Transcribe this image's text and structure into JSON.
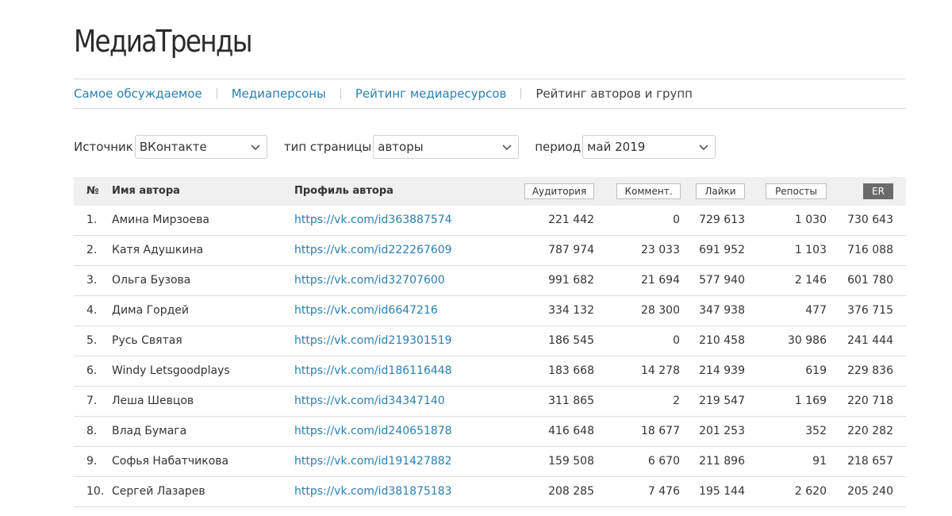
{
  "brand": "МедиаТренды",
  "nav": {
    "items": [
      {
        "label": "Самое обсуждаемое"
      },
      {
        "label": "Медиаперсоны"
      },
      {
        "label": "Рейтинг медиаресурсов"
      }
    ],
    "current": "Рейтинг авторов и групп"
  },
  "filters": {
    "source": {
      "label": "Источник",
      "value": "ВКонтакте"
    },
    "page_type": {
      "label": "тип страницы",
      "value": "авторы"
    },
    "period": {
      "label": "период",
      "value": "май 2019"
    }
  },
  "table": {
    "headers": {
      "num": "№",
      "name": "Имя автора",
      "profile": "Профиль автора",
      "audience": "Аудитория",
      "comments": "Коммент.",
      "likes": "Лайки",
      "reposts": "Репосты",
      "er": "ER"
    },
    "rows": [
      {
        "n": "1.",
        "name": "Амина Мирзоева",
        "url": "https://vk.com/id363887574",
        "audience": "221 442",
        "comments": "0",
        "likes": "729 613",
        "reposts": "1 030",
        "er": "730 643"
      },
      {
        "n": "2.",
        "name": "Катя Адушкина",
        "url": "https://vk.com/id222267609",
        "audience": "787 974",
        "comments": "23 033",
        "likes": "691 952",
        "reposts": "1 103",
        "er": "716 088"
      },
      {
        "n": "3.",
        "name": "Ольга Бузова",
        "url": "https://vk.com/id32707600",
        "audience": "991 682",
        "comments": "21 694",
        "likes": "577 940",
        "reposts": "2 146",
        "er": "601 780"
      },
      {
        "n": "4.",
        "name": "Дима Гордей",
        "url": "https://vk.com/id6647216",
        "audience": "334 132",
        "comments": "28 300",
        "likes": "347 938",
        "reposts": "477",
        "er": "376 715"
      },
      {
        "n": "5.",
        "name": "Русь Святая",
        "url": "https://vk.com/id219301519",
        "audience": "186 545",
        "comments": "0",
        "likes": "210 458",
        "reposts": "30 986",
        "er": "241 444"
      },
      {
        "n": "6.",
        "name": "Windy Letsgoodplays",
        "url": "https://vk.com/id186116448",
        "audience": "183 668",
        "comments": "14 278",
        "likes": "214 939",
        "reposts": "619",
        "er": "229 836"
      },
      {
        "n": "7.",
        "name": "Леша Шевцов",
        "url": "https://vk.com/id34347140",
        "audience": "311 865",
        "comments": "2",
        "likes": "219 547",
        "reposts": "1 169",
        "er": "220 718"
      },
      {
        "n": "8.",
        "name": "Влад Бумага",
        "url": "https://vk.com/id240651878",
        "audience": "416 648",
        "comments": "18 677",
        "likes": "201 253",
        "reposts": "352",
        "er": "220 282"
      },
      {
        "n": "9.",
        "name": "Софья Набатчикова",
        "url": "https://vk.com/id191427882",
        "audience": "159 508",
        "comments": "6 670",
        "likes": "211 896",
        "reposts": "91",
        "er": "218 657"
      },
      {
        "n": "10.",
        "name": "Сергей Лазарев",
        "url": "https://vk.com/id381875183",
        "audience": "208 285",
        "comments": "7 476",
        "likes": "195 144",
        "reposts": "2 620",
        "er": "205 240"
      }
    ]
  },
  "colors": {
    "link": "#2a7fb0",
    "header_bg": "#f0f0f0",
    "active_sort": "#6b6b6b"
  }
}
